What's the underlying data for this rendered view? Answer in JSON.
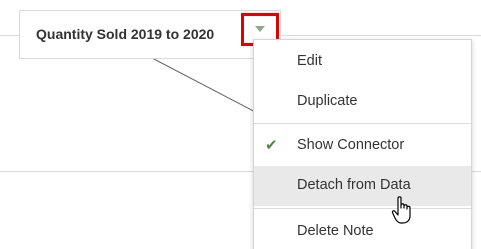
{
  "note": {
    "title": "Quantity Sold 2019 to 2020"
  },
  "menu": {
    "items": [
      {
        "label": "Edit",
        "checked": false
      },
      {
        "label": "Duplicate",
        "checked": false
      },
      {
        "label": "Show Connector",
        "checked": true
      },
      {
        "label": "Detach from Data",
        "checked": false,
        "hovered": true
      },
      {
        "label": "Delete Note",
        "checked": false
      }
    ]
  },
  "icons": {
    "dropdown": "chevron-down-icon",
    "check": "checkmark-icon",
    "pointer": "hand-pointer-cursor-icon"
  },
  "colors": {
    "highlight_border": "#e00000",
    "dropdown_triangle": "#8aab8a",
    "check": "#4d8a44",
    "hover_bg": "#e9e9e9"
  }
}
